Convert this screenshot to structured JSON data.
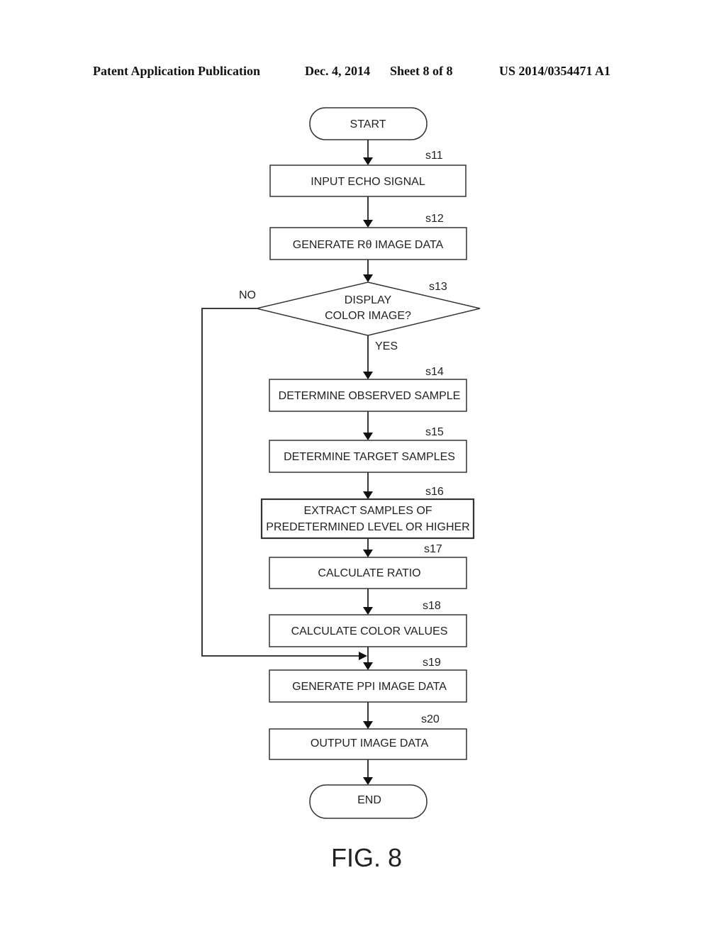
{
  "header": {
    "publication": "Patent Application Publication",
    "date": "Dec. 4, 2014",
    "sheet": "Sheet 8 of 8",
    "number": "US 2014/0354471 A1"
  },
  "flowchart": {
    "start": "START",
    "end": "END",
    "steps": [
      {
        "id": "s11",
        "lines": [
          "INPUT ECHO SIGNAL"
        ]
      },
      {
        "id": "s12",
        "lines": [
          "GENERATE Rθ IMAGE DATA"
        ]
      },
      {
        "id": "s13",
        "lines": [
          "DISPLAY",
          "COLOR IMAGE?"
        ],
        "type": "decision",
        "yes": "YES",
        "no": "NO"
      },
      {
        "id": "s14",
        "lines": [
          "DETERMINE OBSERVED SAMPLE"
        ]
      },
      {
        "id": "s15",
        "lines": [
          "DETERMINE TARGET SAMPLES"
        ]
      },
      {
        "id": "s16",
        "lines": [
          "EXTRACT SAMPLES OF",
          "PREDETERMINED LEVEL OR HIGHER"
        ]
      },
      {
        "id": "s17",
        "lines": [
          "CALCULATE RATIO"
        ]
      },
      {
        "id": "s18",
        "lines": [
          "CALCULATE COLOR VALUES"
        ]
      },
      {
        "id": "s19",
        "lines": [
          "GENERATE PPI IMAGE DATA"
        ]
      },
      {
        "id": "s20",
        "lines": [
          "OUTPUT IMAGE DATA"
        ]
      }
    ]
  },
  "figure_label": "FIG. 8"
}
